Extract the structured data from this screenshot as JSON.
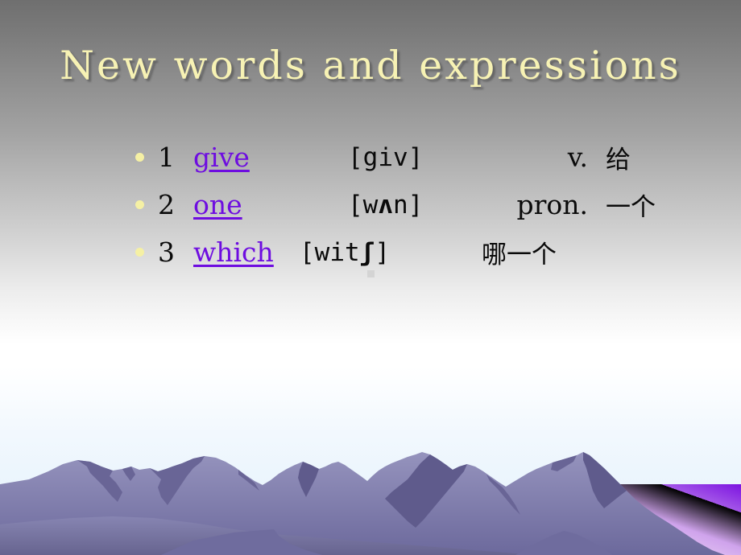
{
  "slide": {
    "title": "New words and expressions",
    "title_color": "#f7f2b4",
    "background_top_color": "#6f6f6f",
    "background_mid_color": "#ffffff",
    "background_bottom_color": "#e6f3fd"
  },
  "word_list": [
    {
      "bullet": "bullet-dot",
      "number": "1",
      "word": "give",
      "phonetic": "[giv]",
      "part_of_speech": "v.",
      "meaning": "给"
    },
    {
      "bullet": "bullet-dot",
      "number": "2",
      "word": "one",
      "phonetic_prefix": "[w",
      "phonetic_symbol": "ʌ",
      "phonetic_suffix": "n]",
      "phonetic": "[wʌn]",
      "part_of_speech": "pron.",
      "meaning": "一个"
    },
    {
      "bullet": "bullet-dot",
      "number": "3",
      "word": "which",
      "phonetic_prefix": "[wit",
      "phonetic_symbol": "ʃ",
      "phonetic_suffix": "]",
      "phonetic": "[witʃ]",
      "part_of_speech": "",
      "meaning": "哪一个"
    }
  ],
  "colors": {
    "link_purple": "#6e0de0",
    "bullet_yellow": "#f5f0a4",
    "mountain_light": "#8d8bb6",
    "mountain_mid": "#7e7ca9",
    "mountain_dark": "#676293",
    "mountain_base": "#6f6c9e",
    "panel_purple_bright": "#7c13e0",
    "panel_purple_pale": "#f3e6fb",
    "sky_pale_blue": "#e6f3fd"
  },
  "scenery": {
    "name": "mountain-range-graphic",
    "panel_label": "purple-gradient-panel"
  }
}
